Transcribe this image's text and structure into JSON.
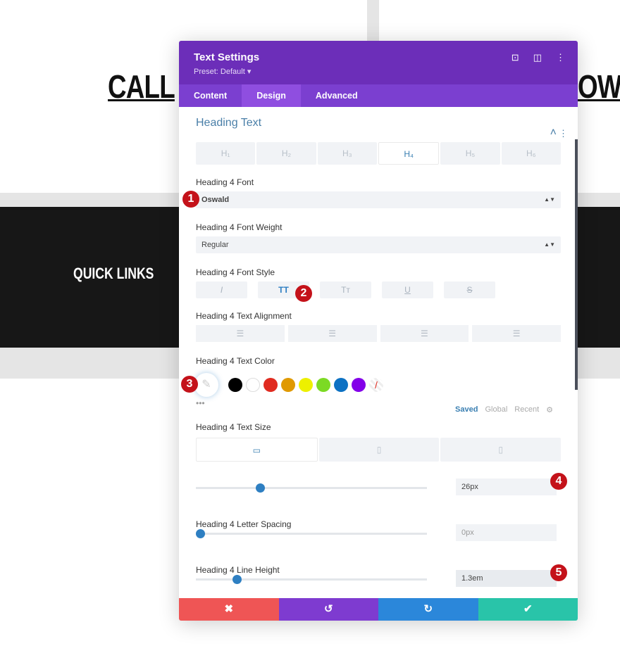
{
  "page": {
    "heading_left": "CALL",
    "heading_right": "OW",
    "quick_links": "QUICK LINKS"
  },
  "modal": {
    "title": "Text Settings",
    "preset": "Preset: Default ▾",
    "icons": [
      "focus-icon",
      "split-view-icon",
      "more-vertical-icon"
    ],
    "tabs": [
      {
        "label": "Content"
      },
      {
        "label": "Design"
      },
      {
        "label": "Advanced"
      }
    ],
    "section": "Heading Text",
    "heading_tabs": [
      "H₁",
      "H₂",
      "H₃",
      "H₄",
      "H₅",
      "H₆"
    ],
    "font_label": "Heading 4 Font",
    "font_value": "Oswald",
    "weight_label": "Heading 4 Font Weight",
    "weight_value": "Regular",
    "style_label": "Heading 4 Font Style",
    "style_buttons": [
      "I",
      "TT",
      "Tт",
      "U",
      "S"
    ],
    "align_label": "Heading 4 Text Alignment",
    "color_label": "Heading 4 Text Color",
    "swatches": [
      "#000000",
      "#ffffff",
      "#e02b20",
      "#e09900",
      "#edf000",
      "#7cda24",
      "#0c71c3",
      "#8300e9"
    ],
    "palette_tabs": [
      "Saved",
      "Global",
      "Recent"
    ],
    "size_label": "Heading 4 Text Size",
    "size_value": "26px",
    "size_slider_pct": 26,
    "spacing_label": "Heading 4 Letter Spacing",
    "spacing_value": "0px",
    "spacing_slider_pct": 0,
    "lh_label": "Heading 4 Line Height",
    "lh_value": "1.3em",
    "lh_slider_pct": 16,
    "footer": {
      "cancel": "✖",
      "undo": "↺",
      "redo": "↻",
      "save": "✔"
    },
    "footer_colors": [
      "#ef5555",
      "#7e3bd0",
      "#2b87da",
      "#29c4a9"
    ]
  },
  "badges": [
    "1",
    "2",
    "3",
    "4",
    "5"
  ],
  "colors": {
    "header": "#6c2eb9",
    "tabs": "#7b3fd0",
    "accent": "#2e7fc2",
    "badge": "#c4121a"
  }
}
